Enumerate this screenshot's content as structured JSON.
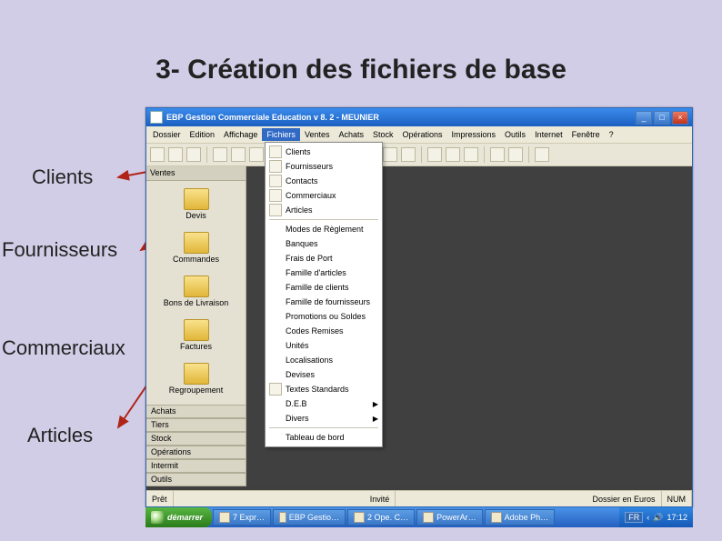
{
  "slide_title": "3- Création des fichiers de base",
  "annotations": {
    "clients": "Clients",
    "fournisseurs": "Fournisseurs",
    "commerciaux": "Commerciaux",
    "articles": "Articles"
  },
  "window": {
    "title": "EBP Gestion Commerciale Education v 8. 2 - MEUNIER",
    "buttons": {
      "min": "_",
      "max": "□",
      "close": "×"
    }
  },
  "menubar": {
    "items": [
      "Dossier",
      "Edition",
      "Affichage",
      "Fichiers",
      "Ventes",
      "Achats",
      "Stock",
      "Opérations",
      "Impressions",
      "Outils",
      "Internet",
      "Fenêtre",
      "?"
    ],
    "active_index": 3
  },
  "toolbar": {
    "icons": [
      "new",
      "open",
      "save",
      "sep",
      "cut",
      "copy",
      "paste",
      "sep",
      "undo",
      "redo",
      "sep",
      "print",
      "preview",
      "sep",
      "c1",
      "c2",
      "c3",
      "sep",
      "client",
      "fourn",
      "comm",
      "sep",
      "mail",
      "web",
      "sep",
      "help"
    ]
  },
  "side_panel": {
    "header": "Ventes",
    "items": [
      {
        "label": "Devis"
      },
      {
        "label": "Commandes"
      },
      {
        "label": "Bons de Livraison"
      },
      {
        "label": "Factures"
      },
      {
        "label": "Regroupement"
      }
    ],
    "sections": [
      "Achats",
      "Tiers",
      "Stock",
      "Opérations",
      "Intermit",
      "Outils"
    ]
  },
  "dropdown": {
    "items": [
      {
        "label": "Clients",
        "icon": true,
        "arrow": false
      },
      {
        "label": "Fournisseurs",
        "icon": true,
        "arrow": false
      },
      {
        "label": "Contacts",
        "icon": true,
        "arrow": false
      },
      {
        "label": "Commerciaux",
        "icon": true,
        "arrow": false
      },
      {
        "label": "Articles",
        "icon": true,
        "arrow": false
      },
      {
        "sep": true
      },
      {
        "label": "Modes de Règlement",
        "icon": false,
        "arrow": false
      },
      {
        "label": "Banques",
        "icon": false,
        "arrow": false
      },
      {
        "label": "Frais de Port",
        "icon": false,
        "arrow": false
      },
      {
        "label": "Famille d'articles",
        "icon": false,
        "arrow": false
      },
      {
        "label": "Famille de clients",
        "icon": false,
        "arrow": false
      },
      {
        "label": "Famille de fournisseurs",
        "icon": false,
        "arrow": false
      },
      {
        "label": "Promotions ou Soldes",
        "icon": false,
        "arrow": false
      },
      {
        "label": "Codes Remises",
        "icon": false,
        "arrow": false
      },
      {
        "label": "Unités",
        "icon": false,
        "arrow": false
      },
      {
        "label": "Localisations",
        "icon": false,
        "arrow": false
      },
      {
        "label": "Devises",
        "icon": false,
        "arrow": false
      },
      {
        "label": "Textes Standards",
        "icon": true,
        "arrow": false
      },
      {
        "label": "D.E.B",
        "icon": false,
        "arrow": true
      },
      {
        "label": "Divers",
        "icon": false,
        "arrow": true
      },
      {
        "sep": true
      },
      {
        "label": "Tableau de bord",
        "icon": false,
        "arrow": false
      }
    ]
  },
  "statusbar": {
    "left": "Prêt",
    "mid": "Invité",
    "right1": "Dossier en Euros",
    "right2": "NUM"
  },
  "taskbar": {
    "start": "démarrer",
    "tasks": [
      "7 Expr…",
      "EBP Gestio…",
      "2 Ope. C…",
      "PowerAr…",
      "Adobe Ph…"
    ],
    "lang": "FR",
    "clock": "17:12"
  }
}
